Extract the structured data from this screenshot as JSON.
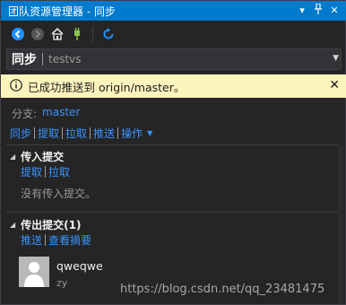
{
  "window": {
    "title": "团队资源管理器 - 同步"
  },
  "navbar": {
    "page": "同步",
    "repo": "testvs"
  },
  "notification": {
    "message": "已成功推送到 origin/master。",
    "close": "✕"
  },
  "branch": {
    "label": "分支:",
    "name": "master"
  },
  "actions": {
    "sync": "同步",
    "fetch": "提取",
    "pull": "拉取",
    "push": "推送",
    "more": "操作"
  },
  "incoming": {
    "title": "传入提交",
    "fetch": "提取",
    "pull": "拉取",
    "empty": "没有传入提交。"
  },
  "outgoing": {
    "title": "传出提交(1)",
    "push": "推送",
    "view_summary": "查看摘要",
    "commits": [
      {
        "message": "qweqwe",
        "author": "zy"
      }
    ]
  },
  "watermark": "https://blog.csdn.net/qq_23481475",
  "colors": {
    "accent": "#007acc",
    "link": "#3794ff",
    "info_bg": "#fcf3bd"
  },
  "icons": [
    "back-icon",
    "forward-icon",
    "home-icon",
    "connect-icon",
    "refresh-icon",
    "info-icon",
    "close-icon",
    "pin-icon",
    "dropdown-icon"
  ]
}
